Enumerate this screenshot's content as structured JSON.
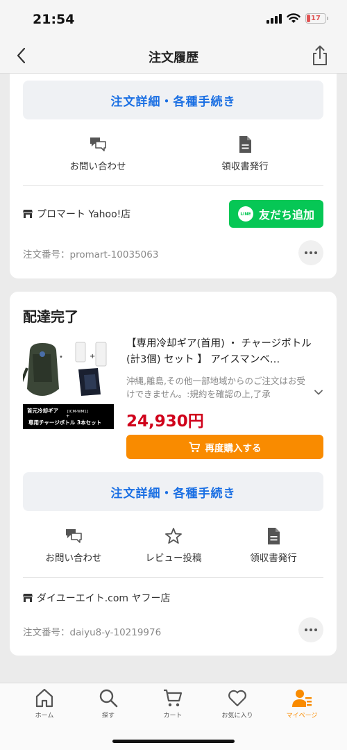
{
  "status_bar": {
    "time": "21:54",
    "battery": "17"
  },
  "nav": {
    "title": "注文履歴"
  },
  "order1": {
    "detail_button": "注文詳細・各種手続き",
    "actions": [
      {
        "label": "お問い合わせ",
        "icon": "chat-icon"
      },
      {
        "label": "領収書発行",
        "icon": "document-icon"
      }
    ],
    "store": "プロマート Yahoo!店",
    "line_button": "友だち追加",
    "line_logo": "LINE",
    "order_number": "注文番号：promart-10035063"
  },
  "order2": {
    "status": "配達完了",
    "product_title": "【専用冷却ギア(首用) ・ チャージボトル (計3個) セット 】 アイスマンベ…",
    "product_note": "沖縄,離島,その他一部地域からのご注文はお受けできません。:規約を確認の上,了承",
    "price": "24,930円",
    "image_caption_line1": "首元冷却ギア",
    "image_caption_tag": "[ICM-WM1]",
    "image_caption_plus": "+",
    "image_caption_line2": "専用チャージボトル 3本セット",
    "rebuy_button": "再度購入する",
    "detail_button": "注文詳細・各種手続き",
    "actions": [
      {
        "label": "お問い合わせ",
        "icon": "chat-icon"
      },
      {
        "label": "レビュー投稿",
        "icon": "star-icon"
      },
      {
        "label": "領収書発行",
        "icon": "document-icon"
      }
    ],
    "store": "ダイユーエイト.com ヤフー店",
    "order_number": "注文番号：daiyu8-y-10219976"
  },
  "tabs": [
    {
      "label": "ホーム",
      "icon": "home-icon",
      "active": false
    },
    {
      "label": "探す",
      "icon": "search-icon",
      "active": false
    },
    {
      "label": "カート",
      "icon": "cart-icon",
      "active": false
    },
    {
      "label": "お気に入り",
      "icon": "heart-icon",
      "active": false
    },
    {
      "label": "マイページ",
      "icon": "user-icon",
      "active": true
    }
  ],
  "colors": {
    "accent_blue": "#1a6fe3",
    "line_green": "#06c755",
    "orange": "#f98b00",
    "price_red": "#d0021b"
  }
}
